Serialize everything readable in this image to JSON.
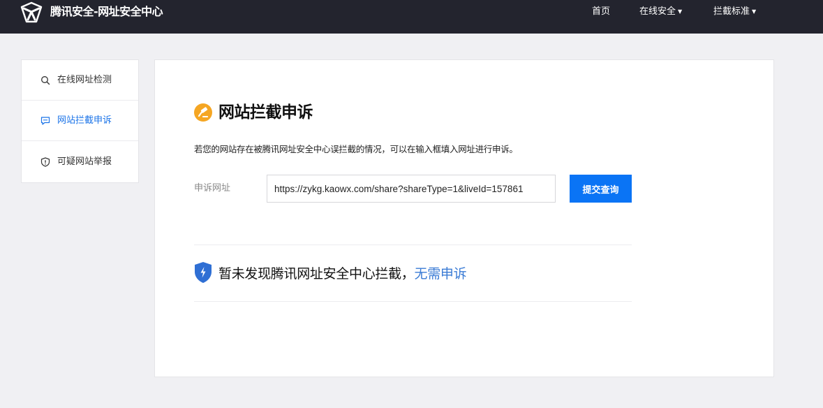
{
  "header": {
    "brand": "腾讯安全-网址安全中心",
    "nav": [
      {
        "label": "首页",
        "has_dropdown": false
      },
      {
        "label": "在线安全",
        "has_dropdown": true
      },
      {
        "label": "拦截标准",
        "has_dropdown": true
      }
    ],
    "caret": "▼"
  },
  "sidebar": {
    "items": [
      {
        "label": "在线网址检测",
        "icon": "search-icon",
        "active": false
      },
      {
        "label": "网站拦截申诉",
        "icon": "chat-icon",
        "active": true
      },
      {
        "label": "可疑网站举报",
        "icon": "shield-alert-icon",
        "active": false
      }
    ]
  },
  "main": {
    "title": "网站拦截申诉",
    "title_icon": "gavel-icon",
    "description": "若您的网站存在被腾讯网址安全中心误拦截的情况，可以在输入框填入网址进行申诉。",
    "form": {
      "label": "申诉网址",
      "url_value": "https://zykg.kaowx.com/share?shareType=1&liveId=157861",
      "submit_label": "提交查询"
    },
    "result": {
      "icon": "shield-lightning-icon",
      "text": "暂未发现腾讯网址安全中心拦截，",
      "link": "无需申诉"
    }
  },
  "colors": {
    "header_bg": "#23242e",
    "accent": "#0a74f5",
    "active_text": "#1a73e8",
    "title_icon": "#f5a623",
    "result_icon": "#2f6fd4",
    "link": "#3a7bd5"
  }
}
